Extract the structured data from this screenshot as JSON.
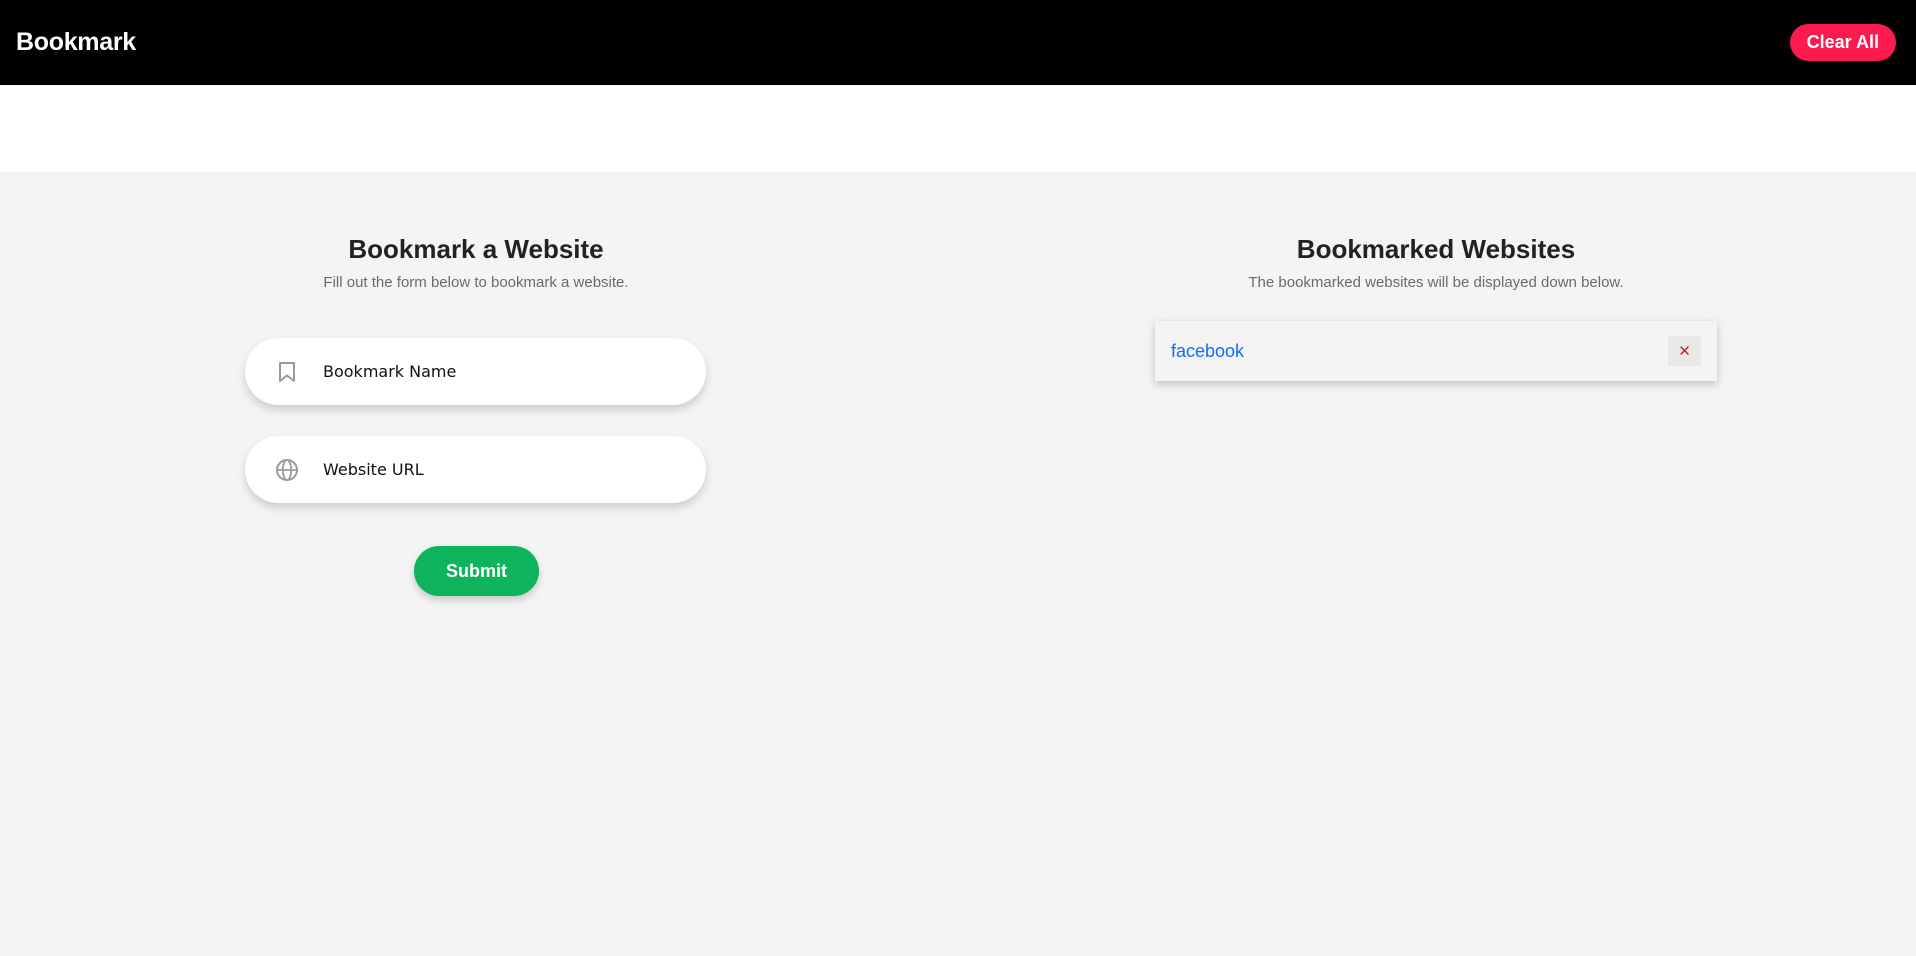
{
  "navbar": {
    "brand": "Bookmark",
    "clear_all_label": "Clear All"
  },
  "form_section": {
    "title": "Bookmark a Website",
    "subtitle": "Fill out the form below to bookmark a website.",
    "name_field": {
      "placeholder": "Bookmark Name",
      "value": "",
      "icon": "bookmark-icon"
    },
    "url_field": {
      "placeholder": "Website URL",
      "value": "",
      "icon": "globe-icon"
    },
    "submit_label": "Submit"
  },
  "list_section": {
    "title": "Bookmarked Websites",
    "subtitle": "The bookmarked websites will be displayed down below.",
    "items": [
      {
        "name": "facebook",
        "delete_icon": "close-icon",
        "delete_glyph": "✕"
      }
    ]
  },
  "colors": {
    "navbar_bg": "#000000",
    "clear_button": "#fc1a4f",
    "submit_button": "#0db45c",
    "link": "#0d6efd",
    "delete_icon": "#e01b1b",
    "page_bg": "#f4f4f4"
  }
}
